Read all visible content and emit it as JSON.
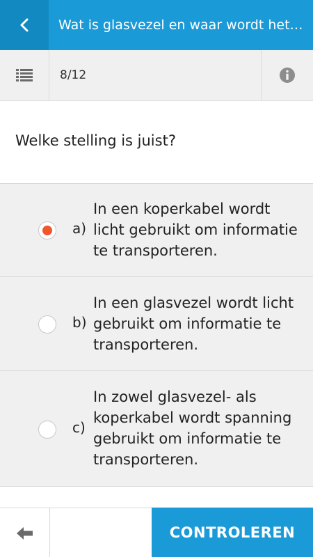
{
  "colors": {
    "accent": "#1a9ad6",
    "accent_dark": "#1389c1",
    "selected_radio": "#f0582b",
    "option_background": "#f0f0f0"
  },
  "header": {
    "back_icon": "chevron-left-icon",
    "title": "Wat is glasvezel en waar wordt het…"
  },
  "toolbar": {
    "list_icon": "list-icon",
    "counter": "8/12",
    "info_icon": "info-icon"
  },
  "question": {
    "text": "Welke stelling is juist?"
  },
  "options": [
    {
      "letter": "a)",
      "lines": [
        "In een koperkabel wordt",
        "licht gebruikt om informatie",
        "te transporteren."
      ],
      "selected": true
    },
    {
      "letter": "b)",
      "lines": [
        "In een glasvezel wordt licht",
        "gebruikt om informatie te",
        "transporteren."
      ],
      "selected": false
    },
    {
      "letter": "c)",
      "lines": [
        "In zowel glasvezel- als",
        "koperkabel wordt spanning",
        "gebruikt om informatie te",
        "transporteren."
      ],
      "selected": false
    }
  ],
  "footer": {
    "prev_icon": "arrow-left-icon",
    "check_label": "CONTROLEREN"
  }
}
